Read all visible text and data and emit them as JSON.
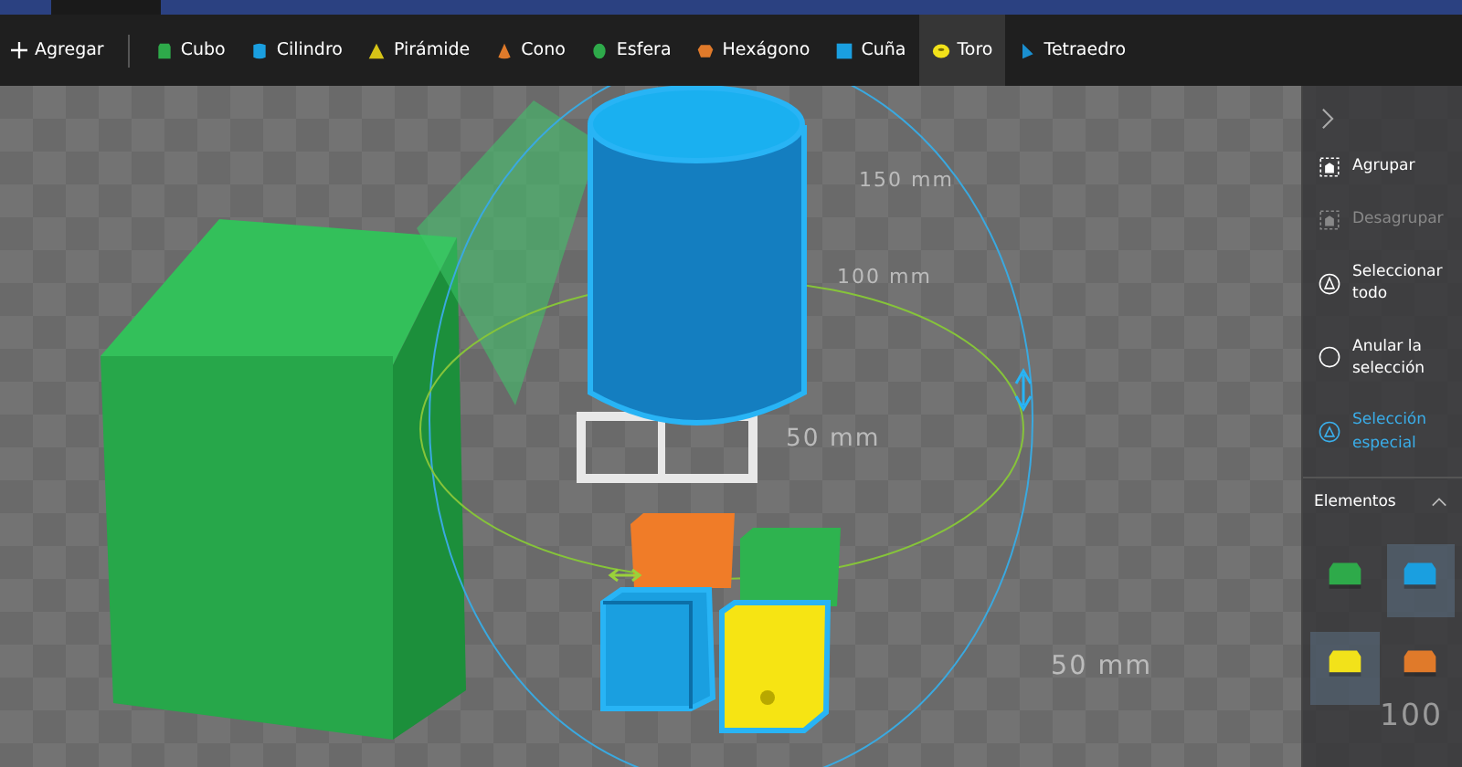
{
  "toolbar": {
    "add_label": "Agregar",
    "shapes": [
      {
        "label": "Cubo",
        "kind": "cube",
        "selected": false
      },
      {
        "label": "Cilindro",
        "kind": "cylinder",
        "selected": false
      },
      {
        "label": "Pirámide",
        "kind": "pyramid",
        "selected": false
      },
      {
        "label": "Cono",
        "kind": "cone",
        "selected": false
      },
      {
        "label": "Esfera",
        "kind": "sphere",
        "selected": false
      },
      {
        "label": "Hexágono",
        "kind": "hexagon",
        "selected": false
      },
      {
        "label": "Cuña",
        "kind": "wedge",
        "selected": false
      },
      {
        "label": "Toro",
        "kind": "torus",
        "selected": true
      },
      {
        "label": "Tetraedro",
        "kind": "tetrahedron",
        "selected": false
      }
    ]
  },
  "viewport": {
    "measure_labels": [
      "150 mm",
      "100 mm",
      "50 mm",
      "50 mm",
      "100"
    ]
  },
  "side_panel": {
    "actions": [
      {
        "label": "Agrupar",
        "kind": "group",
        "disabled": false,
        "selected": false
      },
      {
        "label": "Desagrupar",
        "kind": "ungroup",
        "disabled": true,
        "selected": false
      },
      {
        "label": "Seleccionar todo",
        "kind": "select-all",
        "disabled": false,
        "selected": false
      },
      {
        "label": "Anular la selección",
        "kind": "deselect",
        "disabled": false,
        "selected": false
      },
      {
        "label": "Selección especial",
        "kind": "special",
        "disabled": false,
        "selected": true
      }
    ],
    "elements_title": "Elementos",
    "expanded": true,
    "elements": [
      {
        "color": "#2eaa4a",
        "selected": false
      },
      {
        "color": "#1a9fe0",
        "selected": true
      },
      {
        "color": "#f2e21a",
        "selected": true
      },
      {
        "color": "#e07a2a",
        "selected": false
      }
    ]
  }
}
